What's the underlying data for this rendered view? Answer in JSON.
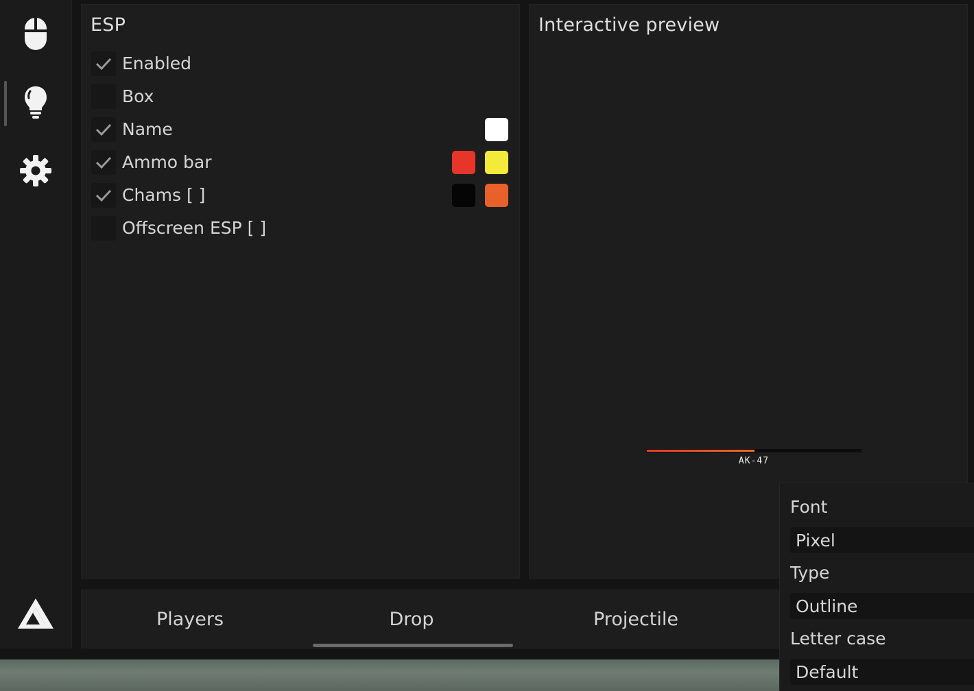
{
  "sidebar": {
    "items": [
      {
        "icon": "mouse-icon",
        "active": false
      },
      {
        "icon": "lightbulb-icon",
        "active": true
      },
      {
        "icon": "gear-icon",
        "active": false
      }
    ],
    "logo": "logo-icon"
  },
  "esp": {
    "title": "ESP",
    "options": [
      {
        "label": "Enabled",
        "checked": true
      },
      {
        "label": "Box",
        "checked": false
      },
      {
        "label": "Name",
        "checked": true,
        "colors": [
          "#ffffff"
        ]
      },
      {
        "label": "Ammo bar",
        "checked": true,
        "colors": [
          "#e8352a",
          "#f4ea3a"
        ]
      },
      {
        "label": "Chams [ ]",
        "checked": true,
        "colors": [
          "#050505",
          "#e8602a"
        ]
      },
      {
        "label": "Offscreen ESP [ ]",
        "checked": false
      }
    ]
  },
  "preview": {
    "title": "Interactive preview",
    "weapon_label": "AK-47",
    "ammo_fraction": 0.5
  },
  "tabs": {
    "items": [
      "Players",
      "Drop",
      "Projectile"
    ],
    "active": "Drop"
  },
  "font_popup": {
    "font_label": "Font",
    "font_value": "Pixel",
    "type_label": "Type",
    "type_value": "Outline",
    "case_label": "Letter case",
    "case_value": "Default"
  },
  "colors": {
    "accent": "#e83f2a",
    "panel_bg": "#1d1d1d",
    "checkbox_bg": "#171717"
  }
}
